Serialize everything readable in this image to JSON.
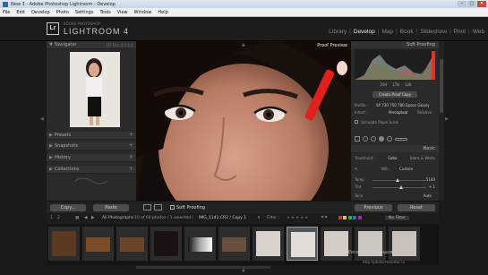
{
  "window": {
    "title": "New 3 - Adobe Photoshop Lightroom - Develop",
    "controls": [
      "–",
      "□",
      "✕"
    ]
  },
  "menu": [
    "File",
    "Edit",
    "Develop",
    "Photo",
    "Settings",
    "Tools",
    "View",
    "Window",
    "Help"
  ],
  "identity": {
    "logo": "Lr",
    "subtitle": "ADOBE PHOTOSHOP",
    "name": "LIGHTROOM 4"
  },
  "modules": [
    {
      "label": "Library",
      "active": false
    },
    {
      "label": "Develop",
      "active": true
    },
    {
      "label": "Map",
      "active": false
    },
    {
      "label": "Book",
      "active": false
    },
    {
      "label": "Slideshow",
      "active": false
    },
    {
      "label": "Print",
      "active": false
    },
    {
      "label": "Web",
      "active": false
    }
  ],
  "left_panel": {
    "navigator": {
      "label": "Navigator",
      "zoom_options": "FIT  FILL  4:1  1:1"
    },
    "sections": [
      "Presets",
      "Snapshots",
      "History",
      "Collections"
    ]
  },
  "center": {
    "proof_preview_label": "Proof Preview"
  },
  "right_panel": {
    "histogram_title": "Soft Proofing",
    "histogram_values": [
      "204",
      "178",
      "128"
    ],
    "create_proof_copy": "Create Proof Copy",
    "profile_label": "Profile :",
    "profile_value": "SP 730 750 780 Epson Glossy",
    "intent_label": "Intent :",
    "intent_value": "Perceptual",
    "intent_alt": "Relative",
    "simulate_label": "Simulate Paper & Ink",
    "basic_label": "Basic",
    "treatment_label": "Treatment :",
    "treatment_color": "Color",
    "treatment_bw": "Black & White",
    "wb_label": "WB :",
    "wb_value": "Custom",
    "temp_label": "Temp",
    "temp_value": "5140",
    "tint_label": "Tint",
    "tint_value": "+ 1",
    "tone_label": "Tone",
    "tone_auto": "Auto"
  },
  "bottom": {
    "copy_label": "Copy...",
    "paste_label": "Paste",
    "soft_proofing_label": "Soft Proofing",
    "previous_label": "Previous",
    "reset_label": "Reset"
  },
  "filmstrip": {
    "page_nums": [
      "1",
      "2"
    ],
    "source": "All Photographs",
    "count": "10 of 60 photos / 1 selected /",
    "filename": "IMG_1141.CR2 / Copy 1",
    "filter_label": "Filter :",
    "no_filter": "No Filter",
    "thumb_count": 11,
    "selected_index": 7
  },
  "watermark": {
    "line1": "Автор: Евгений Карташов",
    "line2": "http://photo-monster.ru"
  },
  "colors": {
    "panel_bg": "#2a2a2a",
    "active_module": "#e6e6e6",
    "inactive_module": "#888888",
    "lipstick": "#e0201c"
  }
}
